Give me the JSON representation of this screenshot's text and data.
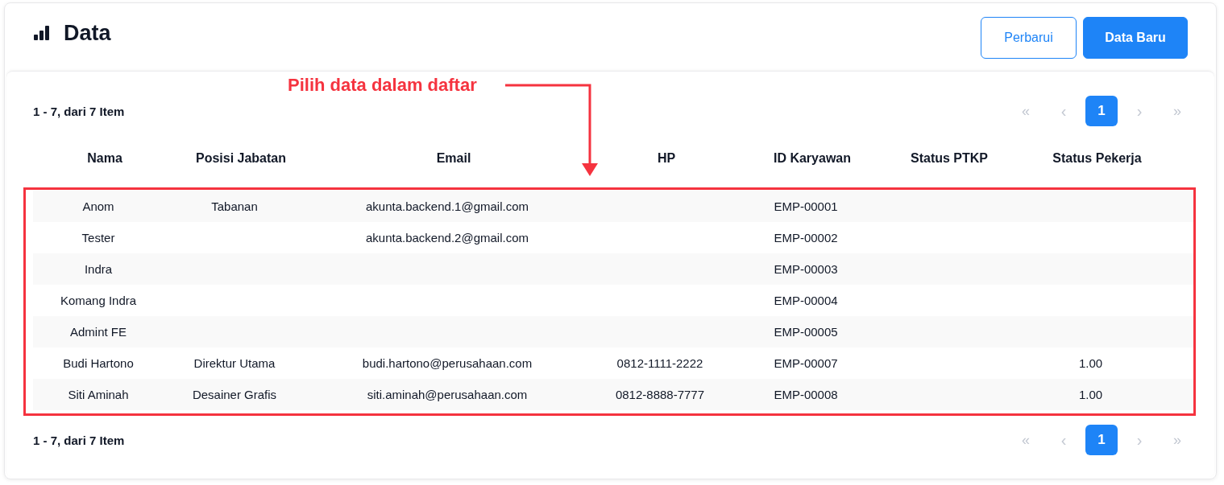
{
  "title": "Data",
  "buttons": [
    {
      "label": "Perbarui",
      "kind": "outline"
    },
    {
      "label": "Data Baru",
      "kind": "primary"
    }
  ],
  "annotation": {
    "text": "Pilih data dalam daftar"
  },
  "pagination_top": {
    "summary": "1 - 7, dari 7 Item",
    "items": [
      {
        "label": "«",
        "kind": "first",
        "disabled": true,
        "selected": false
      },
      {
        "label": "‹",
        "kind": "prev",
        "disabled": true,
        "selected": false
      },
      {
        "label": "1",
        "kind": "page",
        "disabled": false,
        "selected": true
      },
      {
        "label": "›",
        "kind": "next",
        "disabled": true,
        "selected": false
      },
      {
        "label": "»",
        "kind": "last",
        "disabled": true,
        "selected": false
      }
    ]
  },
  "table": {
    "columns": [
      "Nama",
      "Posisi Jabatan",
      "Email",
      "HP",
      "ID Karyawan",
      "Status PTKP",
      "Status Pekerja"
    ],
    "rows": [
      [
        "Anom",
        "Tabanan",
        "akunta.backend.1@gmail.com",
        "",
        "EMP-00001",
        "",
        ""
      ],
      [
        "Tester",
        "",
        "akunta.backend.2@gmail.com",
        "",
        "EMP-00002",
        "",
        ""
      ],
      [
        "Indra",
        "",
        "",
        "",
        "EMP-00003",
        "",
        ""
      ],
      [
        "Komang Indra",
        "",
        "",
        "",
        "EMP-00004",
        "",
        ""
      ],
      [
        "Admint FE",
        "",
        "",
        "",
        "EMP-00005",
        "",
        ""
      ],
      [
        "Budi Hartono",
        "Direktur Utama",
        "budi.hartono@perusahaan.com",
        "0812-1111-2222",
        "EMP-00007",
        "",
        "1.00"
      ],
      [
        "Siti Aminah",
        "Desainer Grafis",
        "siti.aminah@perusahaan.com",
        "0812-8888-7777",
        "EMP-00008",
        "",
        "1.00"
      ]
    ]
  },
  "pagination_bottom": {
    "summary": "1 - 7, dari 7 Item",
    "items": [
      {
        "label": "«",
        "kind": "first",
        "disabled": true,
        "selected": false
      },
      {
        "label": "‹",
        "kind": "prev",
        "disabled": true,
        "selected": false
      },
      {
        "label": "1",
        "kind": "page",
        "disabled": false,
        "selected": true
      },
      {
        "label": "›",
        "kind": "next",
        "disabled": true,
        "selected": false
      },
      {
        "label": "»",
        "kind": "last",
        "disabled": true,
        "selected": false
      }
    ]
  }
}
